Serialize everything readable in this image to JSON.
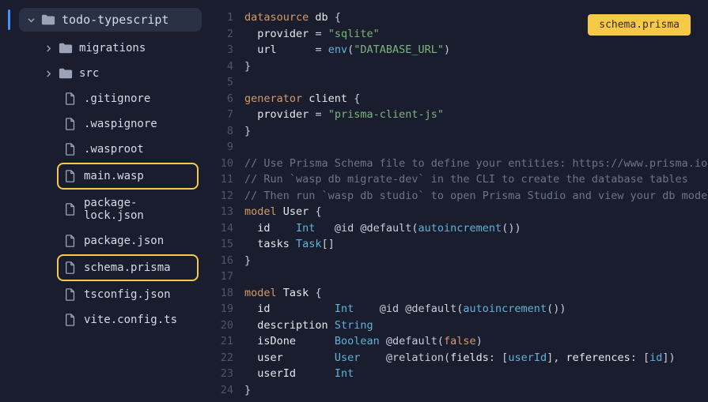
{
  "sidebar": {
    "root": {
      "name": "todo-typescript"
    },
    "items": [
      {
        "name": "migrations",
        "kind": "folder",
        "indent": 1,
        "chev": "right"
      },
      {
        "name": "src",
        "kind": "folder",
        "indent": 1,
        "chev": "right"
      },
      {
        "name": ".gitignore",
        "kind": "file",
        "indent": 2
      },
      {
        "name": ".waspignore",
        "kind": "file",
        "indent": 2
      },
      {
        "name": ".wasproot",
        "kind": "file",
        "indent": 2
      },
      {
        "name": "main.wasp",
        "kind": "file",
        "indent": 2,
        "highlight": true
      },
      {
        "name": "package-lock.json",
        "kind": "file",
        "indent": 2
      },
      {
        "name": "package.json",
        "kind": "file",
        "indent": 2
      },
      {
        "name": "schema.prisma",
        "kind": "file",
        "indent": 2,
        "highlight": true
      },
      {
        "name": "tsconfig.json",
        "kind": "file",
        "indent": 2
      },
      {
        "name": "vite.config.ts",
        "kind": "file",
        "indent": 2
      }
    ]
  },
  "editor": {
    "badge": "schema.prisma",
    "line_count": 24,
    "code_lines": [
      [
        [
          "key",
          "datasource"
        ],
        [
          "sp",
          " "
        ],
        [
          "ident",
          "db"
        ],
        [
          "sp",
          " "
        ],
        [
          "punc",
          "{"
        ]
      ],
      [
        [
          "sp",
          "  "
        ],
        [
          "prop",
          "provider"
        ],
        [
          "sp",
          " "
        ],
        [
          "punc",
          "="
        ],
        [
          "sp",
          " "
        ],
        [
          "str",
          "\"sqlite\""
        ]
      ],
      [
        [
          "sp",
          "  "
        ],
        [
          "prop",
          "url"
        ],
        [
          "sp",
          "      "
        ],
        [
          "punc",
          "="
        ],
        [
          "sp",
          " "
        ],
        [
          "kw2",
          "env"
        ],
        [
          "punc",
          "("
        ],
        [
          "str",
          "\"DATABASE_URL\""
        ],
        [
          "punc",
          ")"
        ]
      ],
      [
        [
          "punc",
          "}"
        ]
      ],
      [],
      [
        [
          "key",
          "generator"
        ],
        [
          "sp",
          " "
        ],
        [
          "ident",
          "client"
        ],
        [
          "sp",
          " "
        ],
        [
          "punc",
          "{"
        ]
      ],
      [
        [
          "sp",
          "  "
        ],
        [
          "prop",
          "provider"
        ],
        [
          "sp",
          " "
        ],
        [
          "punc",
          "="
        ],
        [
          "sp",
          " "
        ],
        [
          "str",
          "\"prisma-client-js\""
        ]
      ],
      [
        [
          "punc",
          "}"
        ]
      ],
      [],
      [
        [
          "com",
          "// Use Prisma Schema file to define your entities: https://www.prisma.io/docs"
        ]
      ],
      [
        [
          "com",
          "// Run `wasp db migrate-dev` in the CLI to create the database tables"
        ]
      ],
      [
        [
          "com",
          "// Then run `wasp db studio` to open Prisma Studio and view your db models"
        ]
      ],
      [
        [
          "key",
          "model"
        ],
        [
          "sp",
          " "
        ],
        [
          "ident",
          "User"
        ],
        [
          "sp",
          " "
        ],
        [
          "punc",
          "{"
        ]
      ],
      [
        [
          "sp",
          "  "
        ],
        [
          "prop",
          "id"
        ],
        [
          "sp",
          "    "
        ],
        [
          "type",
          "Int"
        ],
        [
          "sp",
          "   "
        ],
        [
          "attr",
          "@id @default"
        ],
        [
          "punc",
          "("
        ],
        [
          "func",
          "autoincrement"
        ],
        [
          "punc",
          "())"
        ]
      ],
      [
        [
          "sp",
          "  "
        ],
        [
          "prop",
          "tasks"
        ],
        [
          "sp",
          " "
        ],
        [
          "type",
          "Task"
        ],
        [
          "punc",
          "[]"
        ]
      ],
      [
        [
          "punc",
          "}"
        ]
      ],
      [],
      [
        [
          "key",
          "model"
        ],
        [
          "sp",
          " "
        ],
        [
          "ident",
          "Task"
        ],
        [
          "sp",
          " "
        ],
        [
          "punc",
          "{"
        ]
      ],
      [
        [
          "sp",
          "  "
        ],
        [
          "prop",
          "id"
        ],
        [
          "sp",
          "          "
        ],
        [
          "type",
          "Int"
        ],
        [
          "sp",
          "    "
        ],
        [
          "attr",
          "@id @default"
        ],
        [
          "punc",
          "("
        ],
        [
          "func",
          "autoincrement"
        ],
        [
          "punc",
          "())"
        ]
      ],
      [
        [
          "sp",
          "  "
        ],
        [
          "prop",
          "description"
        ],
        [
          "sp",
          " "
        ],
        [
          "type",
          "String"
        ]
      ],
      [
        [
          "sp",
          "  "
        ],
        [
          "prop",
          "isDone"
        ],
        [
          "sp",
          "      "
        ],
        [
          "type",
          "Boolean"
        ],
        [
          "sp",
          " "
        ],
        [
          "attr",
          "@default"
        ],
        [
          "punc",
          "("
        ],
        [
          "false",
          "false"
        ],
        [
          "punc",
          ")"
        ]
      ],
      [
        [
          "sp",
          "  "
        ],
        [
          "prop",
          "user"
        ],
        [
          "sp",
          "        "
        ],
        [
          "type",
          "User"
        ],
        [
          "sp",
          "    "
        ],
        [
          "attr",
          "@relation"
        ],
        [
          "punc",
          "("
        ],
        [
          "ident",
          "fields"
        ],
        [
          "punc",
          ": ["
        ],
        [
          "field",
          "userId"
        ],
        [
          "punc",
          "], "
        ],
        [
          "ident",
          "references"
        ],
        [
          "punc",
          ": ["
        ],
        [
          "field",
          "id"
        ],
        [
          "punc",
          "])"
        ]
      ],
      [
        [
          "sp",
          "  "
        ],
        [
          "prop",
          "userId"
        ],
        [
          "sp",
          "      "
        ],
        [
          "type",
          "Int"
        ]
      ],
      [
        [
          "punc",
          "}"
        ]
      ]
    ]
  }
}
